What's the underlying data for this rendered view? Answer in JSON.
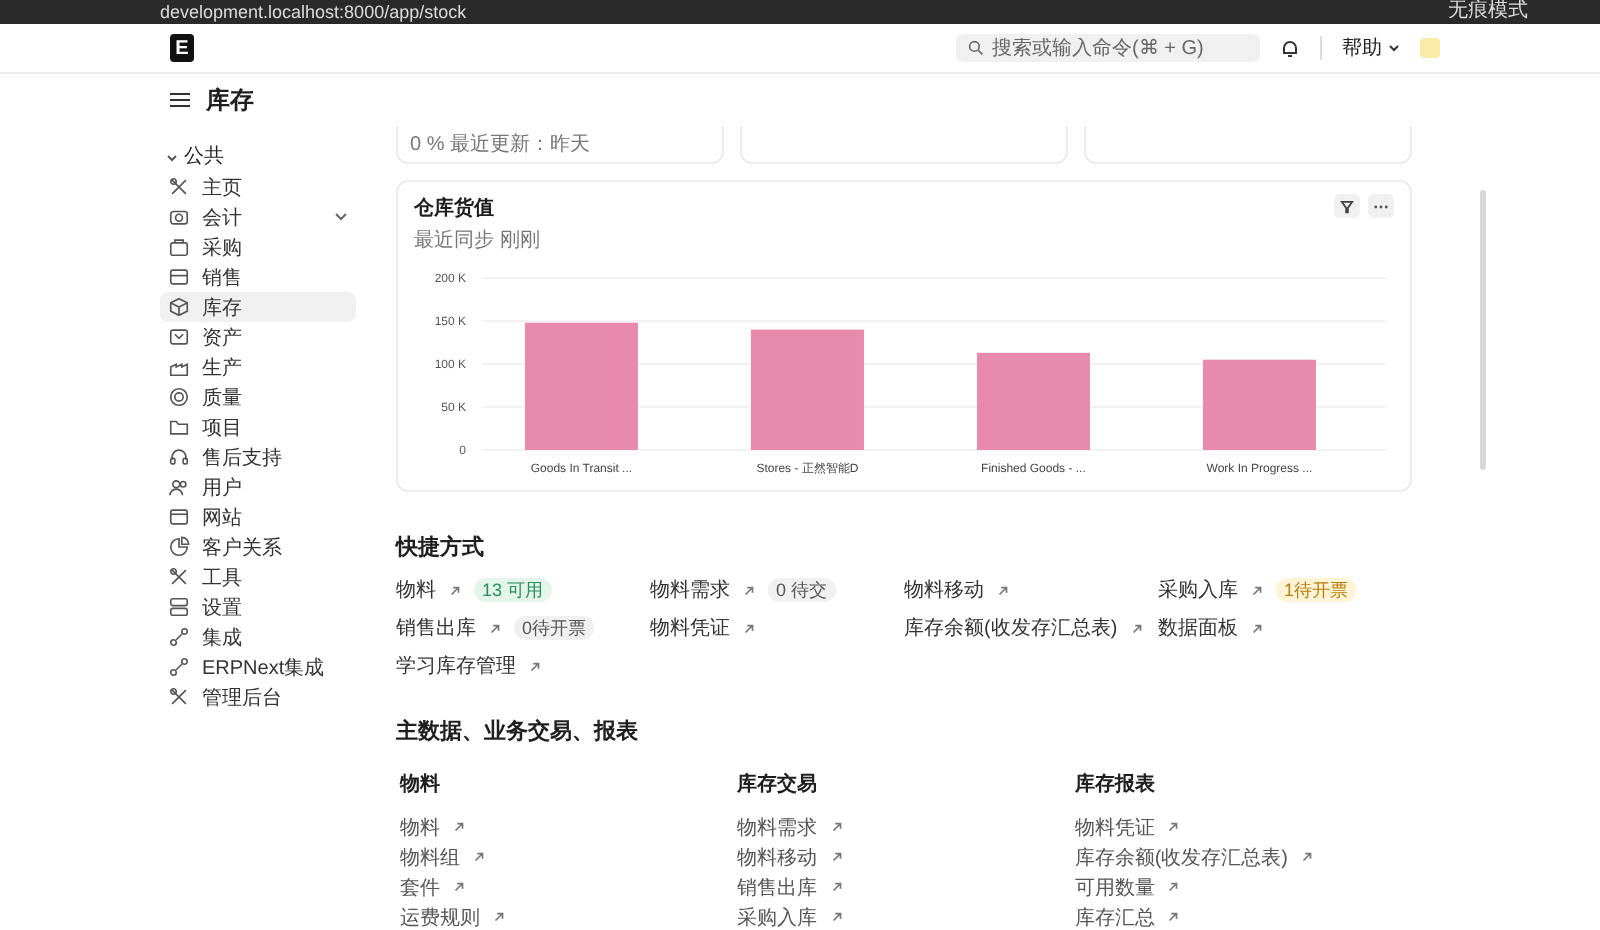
{
  "browser": {
    "url": "development.localhost:8000/app/stock",
    "mode_label": "无痕模式"
  },
  "navbar": {
    "logo": "E",
    "search": {
      "placeholder": "搜索或输入命令(⌘ + G)"
    },
    "help": "帮助"
  },
  "page": {
    "title": "库存"
  },
  "sidebar": {
    "section": "公共",
    "items": [
      {
        "label": "主页",
        "selected": false,
        "has_submenu": false
      },
      {
        "label": "会计",
        "selected": false,
        "has_submenu": true
      },
      {
        "label": "采购",
        "selected": false,
        "has_submenu": false
      },
      {
        "label": "销售",
        "selected": false,
        "has_submenu": false
      },
      {
        "label": "库存",
        "selected": true,
        "has_submenu": false
      },
      {
        "label": "资产",
        "selected": false,
        "has_submenu": false
      },
      {
        "label": "生产",
        "selected": false,
        "has_submenu": false
      },
      {
        "label": "质量",
        "selected": false,
        "has_submenu": false
      },
      {
        "label": "项目",
        "selected": false,
        "has_submenu": false
      },
      {
        "label": "售后支持",
        "selected": false,
        "has_submenu": false
      },
      {
        "label": "用户",
        "selected": false,
        "has_submenu": false
      },
      {
        "label": "网站",
        "selected": false,
        "has_submenu": false
      },
      {
        "label": "客户关系",
        "selected": false,
        "has_submenu": false
      },
      {
        "label": "工具",
        "selected": false,
        "has_submenu": false
      },
      {
        "label": "设置",
        "selected": false,
        "has_submenu": false
      },
      {
        "label": "集成",
        "selected": false,
        "has_submenu": false
      },
      {
        "label": "ERPNext集成",
        "selected": false,
        "has_submenu": false
      },
      {
        "label": "管理后台",
        "selected": false,
        "has_submenu": false
      }
    ]
  },
  "number_cards": [
    {
      "caption": "0 % 最近更新：昨天"
    }
  ],
  "chart_card": {
    "title": "仓库货值",
    "subtitle": "最近同步 刚刚",
    "chart_data": {
      "type": "bar",
      "categories": [
        "Goods In Transit ...",
        "Stores - 正然智能D",
        "Finished Goods - ...",
        "Work In Progress ..."
      ],
      "series": [
        {
          "color": "#e78aac",
          "values": [
            148000,
            140000,
            113000,
            105000
          ]
        }
      ],
      "grid": true,
      "ylim": [
        0,
        200000
      ],
      "yticks": [
        {
          "value": 0,
          "label": "0"
        },
        {
          "value": 50000,
          "label": "50 K"
        },
        {
          "value": 100000,
          "label": "100 K"
        },
        {
          "value": 150000,
          "label": "150 K"
        },
        {
          "value": 200000,
          "label": "200 K"
        }
      ]
    }
  },
  "shortcuts": {
    "title": "快捷方式",
    "items": [
      {
        "label": "物料",
        "badge": {
          "text": "13 可用",
          "kind": "success"
        }
      },
      {
        "label": "物料需求",
        "badge": {
          "text": "0 待交",
          "kind": "neutral"
        }
      },
      {
        "label": "物料移动"
      },
      {
        "label": "采购入库",
        "badge": {
          "text": "1待开票",
          "kind": "warning"
        }
      },
      {
        "label": "销售出库",
        "badge": {
          "text": "0待开票",
          "kind": "neutral"
        }
      },
      {
        "label": "物料凭证"
      },
      {
        "label": "库存余额(收发存汇总表)"
      },
      {
        "label": "数据面板"
      },
      {
        "label": "学习库存管理"
      }
    ]
  },
  "masters": {
    "title": "主数据、业务交易、报表",
    "columns": [
      {
        "heading": "物料",
        "links": [
          "物料",
          "物料组",
          "套件",
          "运费规则"
        ]
      },
      {
        "heading": "库存交易",
        "links": [
          "物料需求",
          "物料移动",
          "销售出库",
          "采购入库"
        ]
      },
      {
        "heading": "库存报表",
        "links": [
          "物料凭证",
          "库存余额(收发存汇总表)",
          "可用数量",
          "库存汇总"
        ]
      }
    ]
  }
}
